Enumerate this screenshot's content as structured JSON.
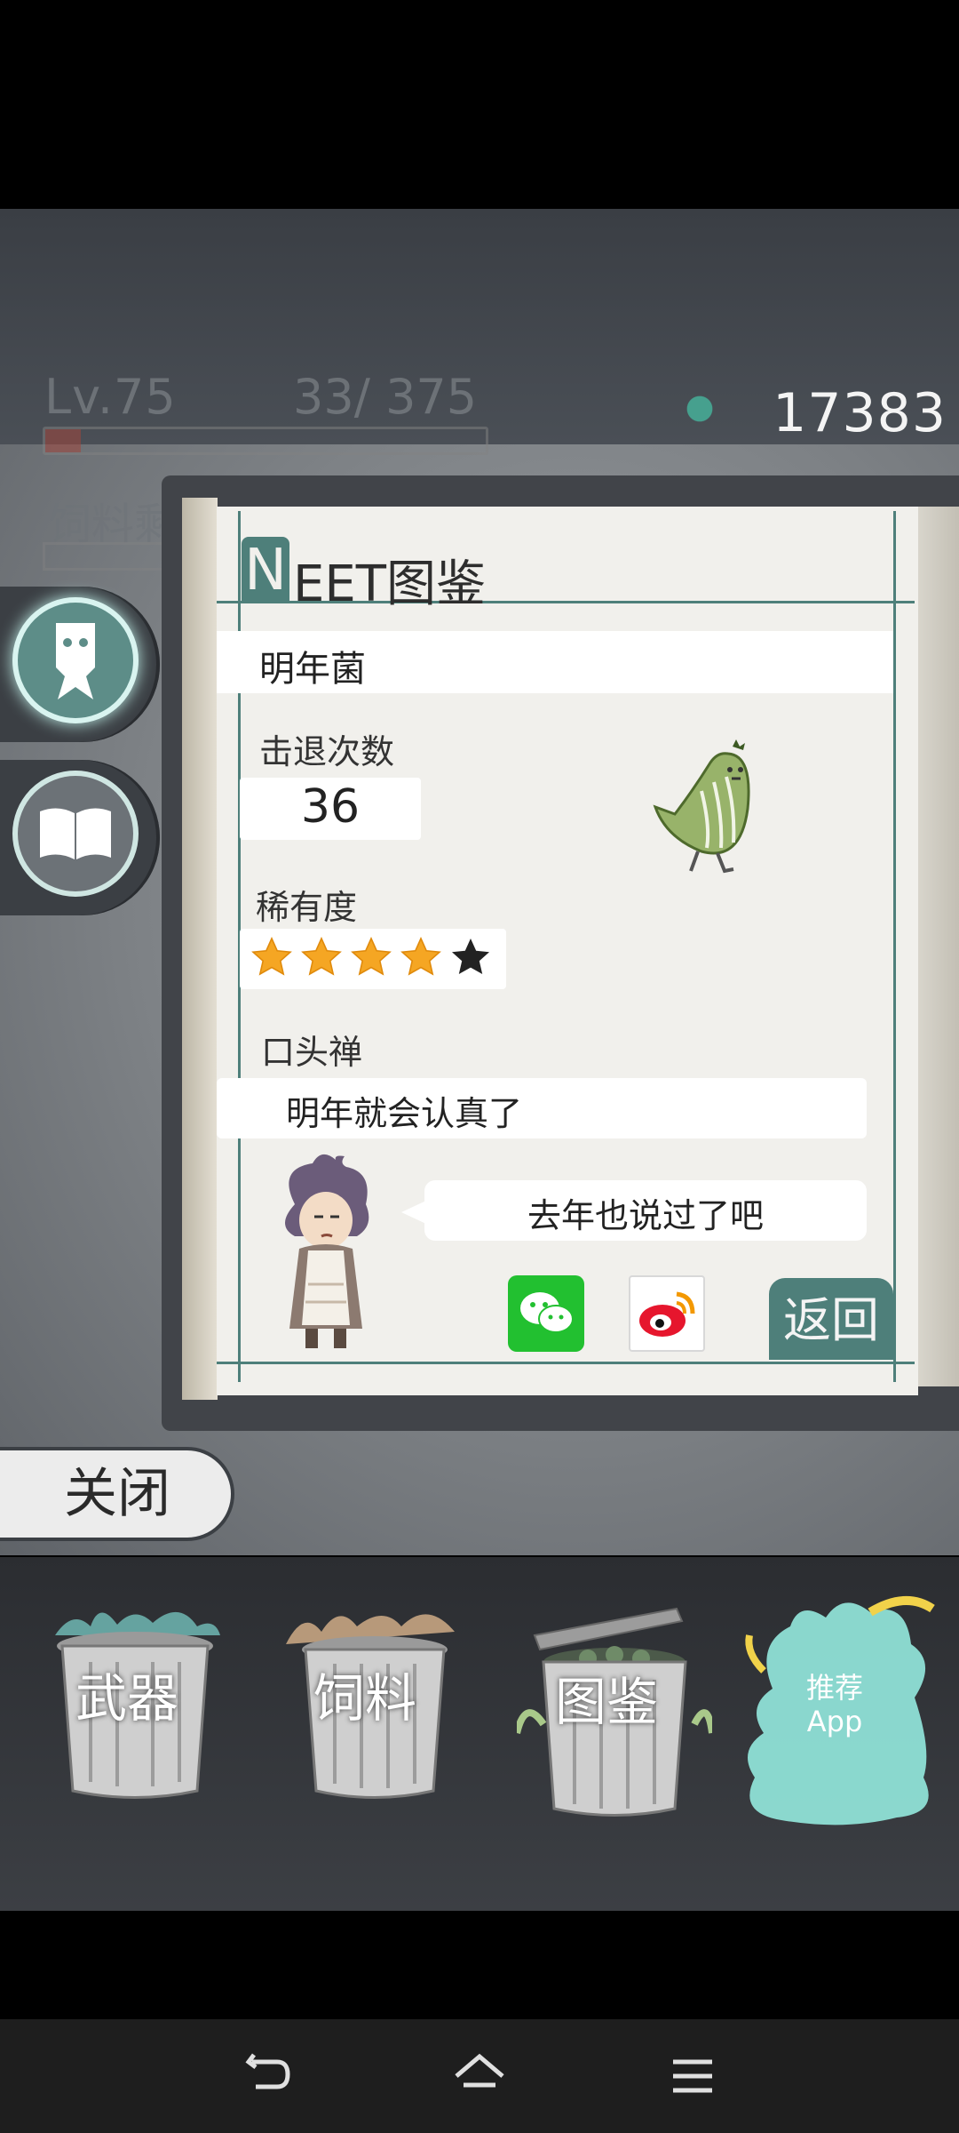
{
  "hud": {
    "level": "Lv.75",
    "exp": "33/  375",
    "feed_label": "饲料剩",
    "exp_fill_fraction": 0.08,
    "coins": "17383"
  },
  "side_tabs": [
    {
      "name": "neet",
      "icon": "ghost-figure-icon",
      "active": true
    },
    {
      "name": "book",
      "icon": "open-book-icon",
      "active": false
    }
  ],
  "dex": {
    "title_letter": "N",
    "title_rest": "EET图鉴",
    "name": "明年菌",
    "repel_label": "击退次数",
    "repel_count": "36",
    "rarity_label": "稀有度",
    "rarity_filled": 4,
    "rarity_max": 5,
    "catchphrase_label": "口头禅",
    "catchphrase": "明年就会认真了",
    "speech": "去年也说过了吧",
    "back_label": "返回",
    "share_icons": [
      "wechat-icon",
      "weibo-icon"
    ]
  },
  "close_label": "关闭",
  "bottom_menu": {
    "weapon": "武器",
    "feed": "饲料",
    "dex": "图鉴",
    "recommend_line1": "推荐",
    "recommend_line2": "App"
  },
  "colors": {
    "accent": "#4e7f7a",
    "page": "#f1f0ec",
    "star": "#f5a623",
    "star_empty": "#222222"
  },
  "system_nav": [
    "back-icon",
    "home-icon",
    "menu-icon"
  ]
}
